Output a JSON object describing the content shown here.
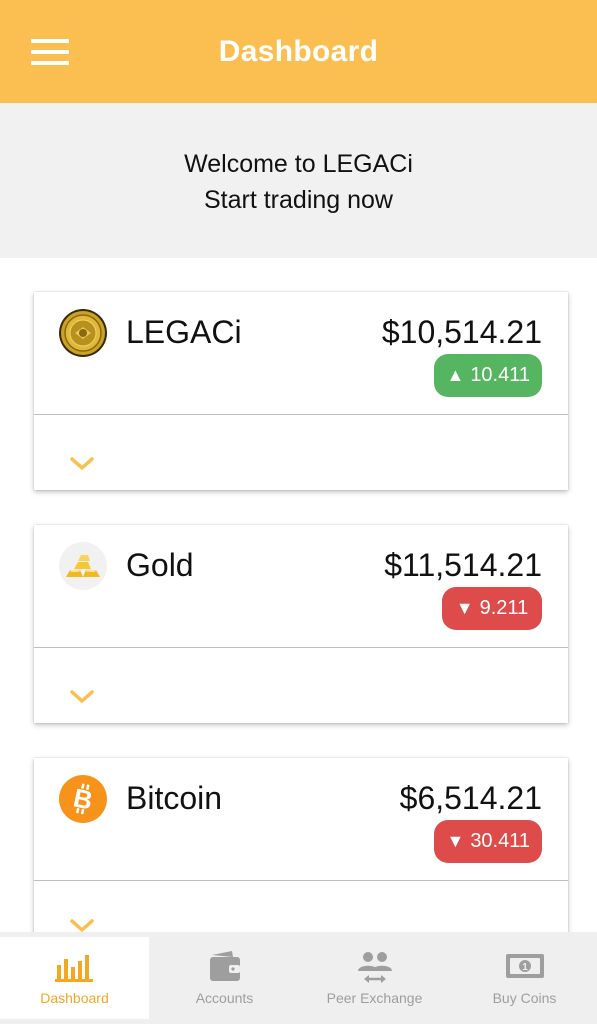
{
  "header": {
    "title": "Dashboard",
    "menu_icon": "hamburger-menu-icon",
    "background_color": "#FBBE50"
  },
  "welcome": {
    "line1": "Welcome to LEGACi",
    "line2": "Start trading now"
  },
  "cards": [
    {
      "name": "LEGACi",
      "price": "$10,514.21",
      "change": "10.411",
      "direction": "up",
      "icon": "legaci-coin-icon"
    },
    {
      "name": "Gold",
      "price": "$11,514.21",
      "change": "9.211",
      "direction": "down",
      "icon": "gold-bars-icon"
    },
    {
      "name": "Bitcoin",
      "price": "$6,514.21",
      "change": "30.411",
      "direction": "down",
      "icon": "bitcoin-icon"
    }
  ],
  "colors": {
    "up": "#55B560",
    "down": "#DE4B4B",
    "accent": "#F5A623"
  },
  "bottom_nav": {
    "items": [
      {
        "label": "Dashboard",
        "icon": "bar-chart-icon",
        "active": true
      },
      {
        "label": "Accounts",
        "icon": "wallet-icon",
        "active": false
      },
      {
        "label": "Peer Exchange",
        "icon": "peer-exchange-icon",
        "active": false
      },
      {
        "label": "Buy Coins",
        "icon": "banknote-icon",
        "active": false
      }
    ]
  }
}
